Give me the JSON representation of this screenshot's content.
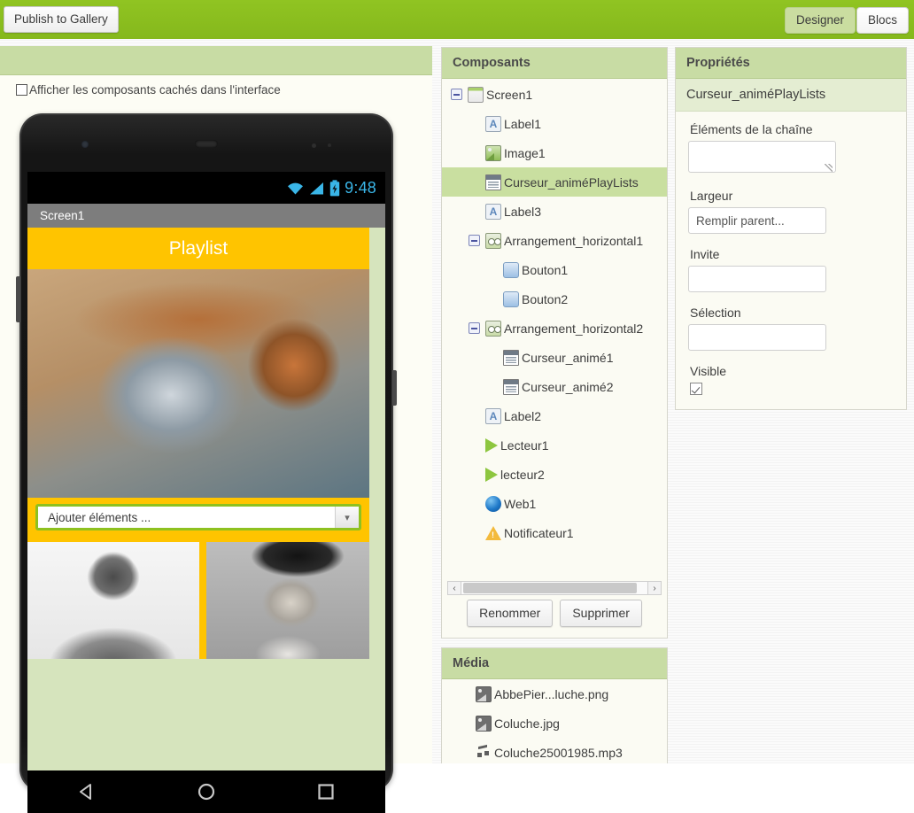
{
  "topbar": {
    "publish_label": "Publish to Gallery",
    "designer_tab": "Designer",
    "blocks_tab": "Blocs",
    "accent_green": "#8ec11f",
    "active_tab_bg": "#cadda0"
  },
  "viewer": {
    "show_hidden_label": "Afficher les composants cachés dans l'interface",
    "show_hidden_checked": false,
    "phone": {
      "status_time": "9:48",
      "status_icons": [
        "wifi-icon",
        "signal-icon",
        "battery-icon"
      ],
      "screen_title": "Screen1",
      "label1_text": "Playlist",
      "label1_bg": "#ffc400",
      "spinner_text": "Ajouter éléments ...",
      "spinner_selected_border": "#8ec11f",
      "image1_name": "headphones-photo",
      "portrait1_name": "coluche-photo",
      "portrait2_name": "abbe-pierre-photo",
      "nav_buttons": [
        "back-icon",
        "home-icon",
        "recents-icon"
      ]
    }
  },
  "components": {
    "title": "Composants",
    "tree": [
      {
        "label": "Screen1",
        "icon": "screen-icon",
        "depth": 0,
        "toggler": true,
        "selected": false
      },
      {
        "label": "Label1",
        "icon": "label-icon",
        "depth": 1,
        "toggler": false,
        "selected": false
      },
      {
        "label": "Image1",
        "icon": "image-icon",
        "depth": 1,
        "toggler": false,
        "selected": false
      },
      {
        "label": "Curseur_animéPlayLists",
        "icon": "spinner-icon",
        "depth": 1,
        "toggler": false,
        "selected": true
      },
      {
        "label": "Label3",
        "icon": "label-icon",
        "depth": 1,
        "toggler": false,
        "selected": false
      },
      {
        "label": "Arrangement_horizontal1",
        "icon": "arrangement-icon",
        "depth": 1,
        "toggler": true,
        "selected": false
      },
      {
        "label": "Bouton1",
        "icon": "button-icon",
        "depth": 2,
        "toggler": false,
        "selected": false
      },
      {
        "label": "Bouton2",
        "icon": "button-icon",
        "depth": 2,
        "toggler": false,
        "selected": false
      },
      {
        "label": "Arrangement_horizontal2",
        "icon": "arrangement-icon",
        "depth": 1,
        "toggler": true,
        "selected": false
      },
      {
        "label": "Curseur_animé1",
        "icon": "spinner-icon",
        "depth": 2,
        "toggler": false,
        "selected": false
      },
      {
        "label": "Curseur_animé2",
        "icon": "spinner-icon",
        "depth": 2,
        "toggler": false,
        "selected": false
      },
      {
        "label": "Label2",
        "icon": "label-icon",
        "depth": 1,
        "toggler": false,
        "selected": false
      },
      {
        "label": "Lecteur1",
        "icon": "player-icon",
        "depth": 1,
        "toggler": false,
        "selected": false
      },
      {
        "label": "lecteur2",
        "icon": "player-icon",
        "depth": 1,
        "toggler": false,
        "selected": false
      },
      {
        "label": "Web1",
        "icon": "web-icon",
        "depth": 1,
        "toggler": false,
        "selected": false
      },
      {
        "label": "Notificateur1",
        "icon": "notifier-icon",
        "depth": 1,
        "toggler": false,
        "selected": false
      }
    ],
    "rename_label": "Renommer",
    "delete_label": "Supprimer",
    "scroll_left": "‹",
    "scroll_right": "›"
  },
  "media": {
    "title": "Média",
    "files": [
      {
        "name": "AbbePier...luche.png",
        "icon": "image-file-icon"
      },
      {
        "name": "Coluche.jpg",
        "icon": "image-file-icon"
      },
      {
        "name": "Coluche25001985.mp3",
        "icon": "sound-file-icon"
      }
    ]
  },
  "properties": {
    "title": "Propriétés",
    "component_name": "Curseur_animéPlayLists",
    "fields": [
      {
        "label": "Éléments de la chaîne",
        "value": "",
        "type": "textarea"
      },
      {
        "label": "Largeur",
        "value": "Remplir parent...",
        "type": "text"
      },
      {
        "label": "Invite",
        "value": "",
        "type": "text"
      },
      {
        "label": "Sélection",
        "value": "",
        "type": "text"
      },
      {
        "label": "Visible",
        "value": "",
        "type": "checkbox",
        "checked": true
      }
    ]
  }
}
